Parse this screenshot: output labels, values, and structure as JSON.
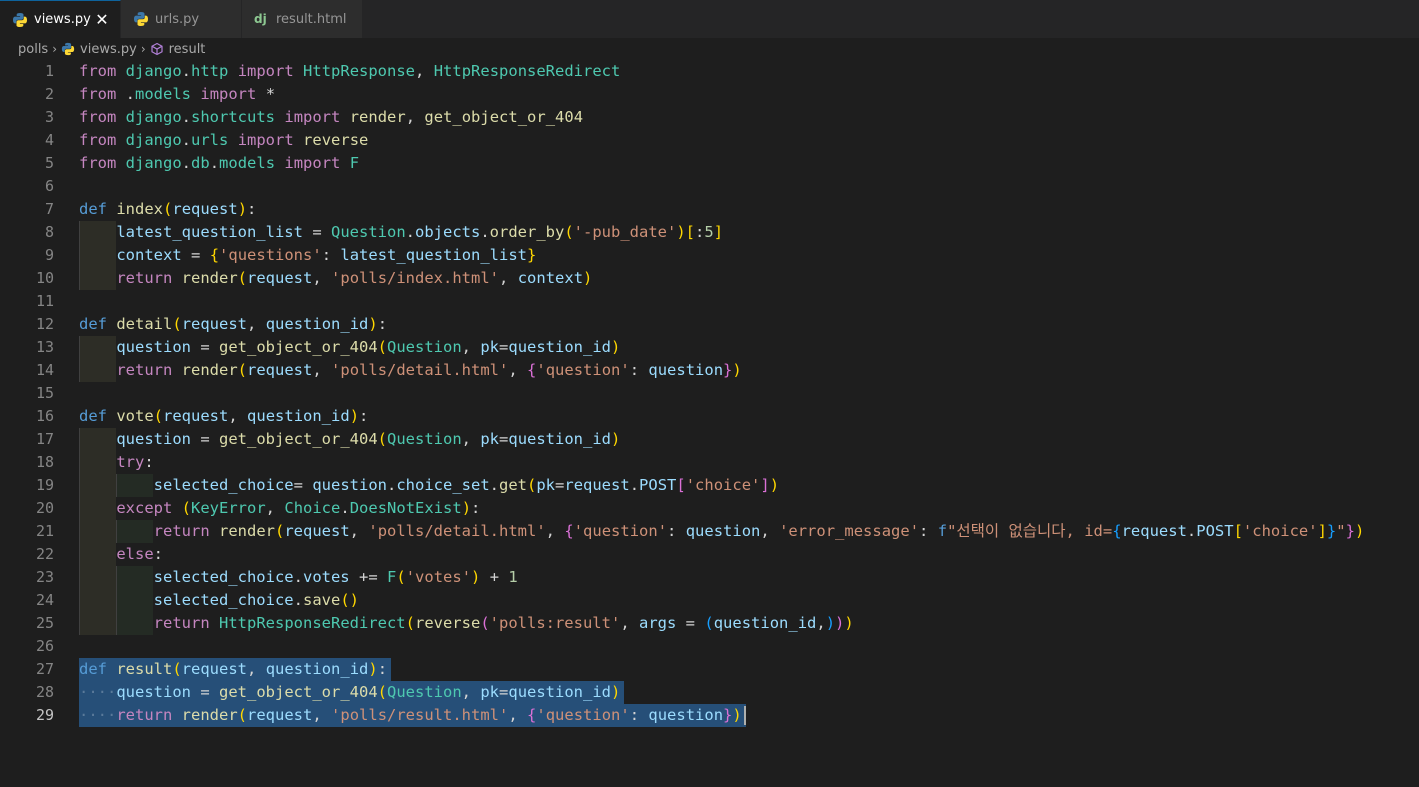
{
  "tabs": [
    {
      "label": "views.py",
      "icon": "python-icon",
      "active": true,
      "close": "✕"
    },
    {
      "label": "urls.py",
      "icon": "python-icon",
      "active": false
    },
    {
      "label": "result.html",
      "icon": "django-icon",
      "active": false,
      "icon_text": "dj"
    }
  ],
  "breadcrumb": {
    "folder": "polls",
    "file": "views.py",
    "symbol": "result"
  },
  "colors": {
    "background": "#1e1e1e",
    "keyword": "#c586c0",
    "def": "#569cd6",
    "function": "#dcdcaa",
    "class": "#4ec9b0",
    "variable": "#9cdcfe",
    "string": "#ce9178",
    "selection": "#264f78"
  },
  "editor": {
    "language": "python",
    "current_line": 29,
    "line_numbers": [
      "1",
      "2",
      "3",
      "4",
      "5",
      "6",
      "7",
      "8",
      "9",
      "10",
      "11",
      "12",
      "13",
      "14",
      "15",
      "16",
      "17",
      "18",
      "19",
      "20",
      "21",
      "22",
      "23",
      "24",
      "25",
      "26",
      "27",
      "28",
      "29"
    ],
    "lines": [
      "from django.http import HttpResponse, HttpResponseRedirect",
      "from .models import *",
      "from django.shortcuts import render, get_object_or_404",
      "from django.urls import reverse",
      "from django.db.models import F",
      "",
      "def index(request):",
      "    latest_question_list = Question.objects.order_by('-pub_date')[:5]",
      "    context = {'questions': latest_question_list}",
      "    return render(request, 'polls/index.html', context)",
      "",
      "def detail(request, question_id):",
      "    question = get_object_or_404(Question, pk=question_id)",
      "    return render(request, 'polls/detail.html', {'question': question})",
      "",
      "def vote(request, question_id):",
      "    question = get_object_or_404(Question, pk=question_id)",
      "    try:",
      "        selected_choice= question.choice_set.get(pk=request.POST['choice'])",
      "    except (KeyError, Choice.DoesNotExist):",
      "        return render(request, 'polls/detail.html', {'question': question, 'error_message': f\"선택이 없습니다, id={request.POST['choice']}\"})",
      "    else:",
      "        selected_choice.votes += F('votes') + 1",
      "        selected_choice.save()",
      "        return HttpResponseRedirect(reverse('polls:result', args = (question_id,)))",
      "",
      "def result(request, question_id):",
      "    question = get_object_or_404(Question, pk=question_id)",
      "    return render(request, 'polls/result.html', {'question': question})"
    ]
  }
}
